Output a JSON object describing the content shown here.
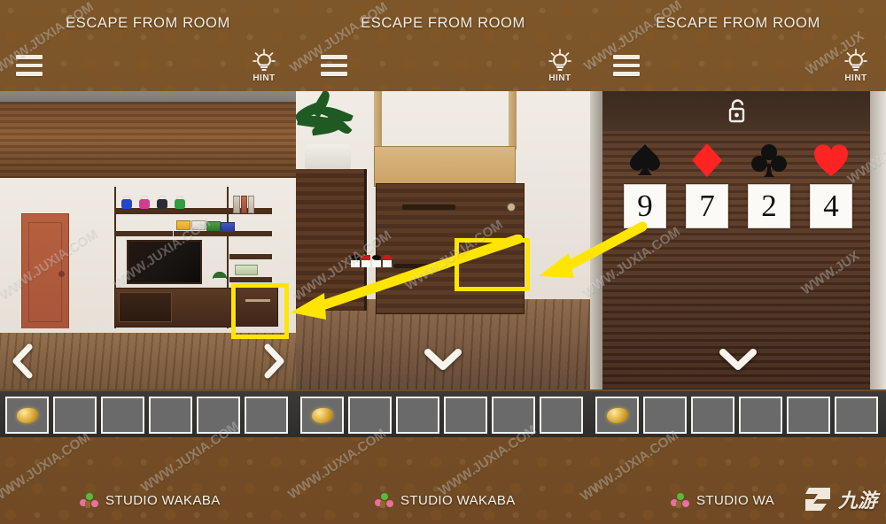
{
  "app": {
    "title": "ESCAPE FROM ROOM",
    "menu_icon": "hamburger-menu-icon",
    "hint_icon": "lightbulb-hint-icon",
    "hint_label": "HINT"
  },
  "panels": [
    {
      "id": "panel-1",
      "title": "ESCAPE FROM ROOM",
      "hint_label": "HINT",
      "scene_name": "living-room",
      "nav": {
        "left": "‹",
        "right": "›"
      },
      "highlight": "cabinet-drawer-highlight"
    },
    {
      "id": "panel-2",
      "title": "ESCAPE FROM ROOM",
      "hint_label": "HINT",
      "scene_name": "cabinet-closeup",
      "nav": {
        "down": "⌄"
      },
      "highlight": "suit-lock-highlight"
    },
    {
      "id": "panel-3",
      "title": "ESCAPE FROM ROOM",
      "hint_label": "HINT",
      "scene_name": "suit-number-lock",
      "nav": {
        "down": "⌄"
      },
      "lock_icon": "open-padlock-icon"
    }
  ],
  "puzzle": {
    "suits": [
      "spade",
      "diamond",
      "club",
      "heart"
    ],
    "suit_colors": [
      "#111111",
      "#ff2323",
      "#111111",
      "#ff2323"
    ],
    "digits": [
      "9",
      "7",
      "2",
      "4"
    ]
  },
  "inventory": {
    "slot_count": 6,
    "items": [
      "gold-nugget",
      "",
      "",
      "",
      "",
      ""
    ]
  },
  "footer": {
    "studio": "STUDIO WAKABA",
    "studio_truncated": "STUDIO WA",
    "logo_text": "九游"
  },
  "watermark": {
    "text": "WWW.JUXIA.COM",
    "short": "WWW.JUX"
  },
  "colors": {
    "background": "#7a5428",
    "highlight": "#ffe500",
    "red_suit": "#ff2323",
    "inventory_slot": "#6a6a6a"
  }
}
